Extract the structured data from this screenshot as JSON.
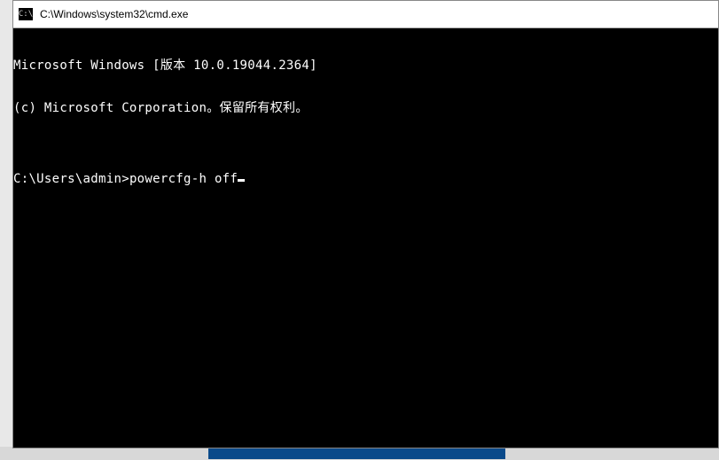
{
  "titlebar": {
    "icon_label": "C:\\",
    "title": "C:\\Windows\\system32\\cmd.exe"
  },
  "terminal": {
    "header_line1": "Microsoft Windows [版本 10.0.19044.2364]",
    "header_line2": "(c) Microsoft Corporation。保留所有权利。",
    "blank": "",
    "prompt": "C:\\Users\\admin>",
    "command": "powercfg-h off"
  }
}
